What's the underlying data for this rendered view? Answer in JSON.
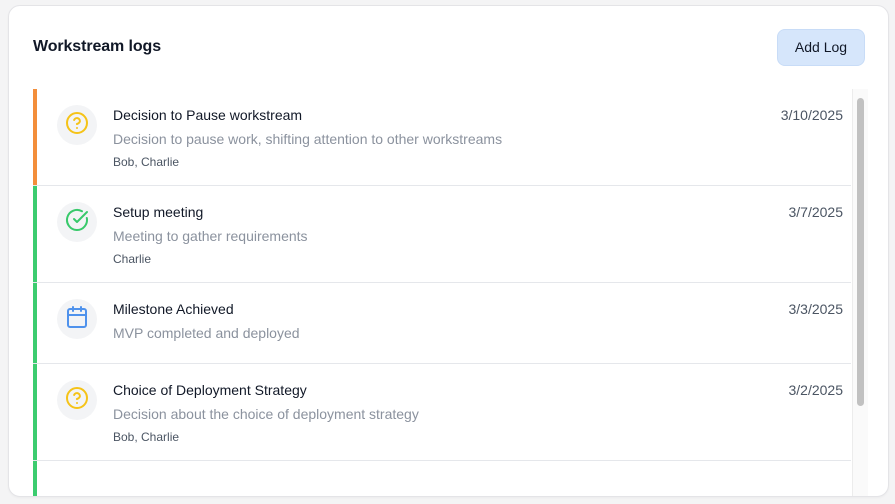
{
  "header": {
    "title": "Workstream logs",
    "add_button_label": "Add Log"
  },
  "logs": [
    {
      "title": "Decision to Pause workstream",
      "description": "Decision to pause work, shifting attention to other workstreams",
      "people": "Bob, Charlie",
      "date": "3/10/2025",
      "icon": "question-circle-icon",
      "status_color": "#f38e3a"
    },
    {
      "title": "Setup meeting",
      "description": "Meeting to gather requirements",
      "people": "Charlie",
      "date": "3/7/2025",
      "icon": "check-circle-icon",
      "status_color": "#3ccc6f"
    },
    {
      "title": "Milestone Achieved",
      "description": "MVP completed and deployed",
      "people": "",
      "date": "3/3/2025",
      "icon": "calendar-icon",
      "status_color": "#3ccc6f"
    },
    {
      "title": "Choice of Deployment Strategy",
      "description": "Decision about the choice of deployment strategy",
      "people": "Bob, Charlie",
      "date": "3/2/2025",
      "icon": "question-circle-icon",
      "status_color": "#3ccc6f"
    }
  ],
  "next_row_status_color": "#3ccc6f",
  "icon_colors": {
    "question": "#f5c318",
    "check": "#38c96b",
    "calendar": "#4f92ec"
  }
}
